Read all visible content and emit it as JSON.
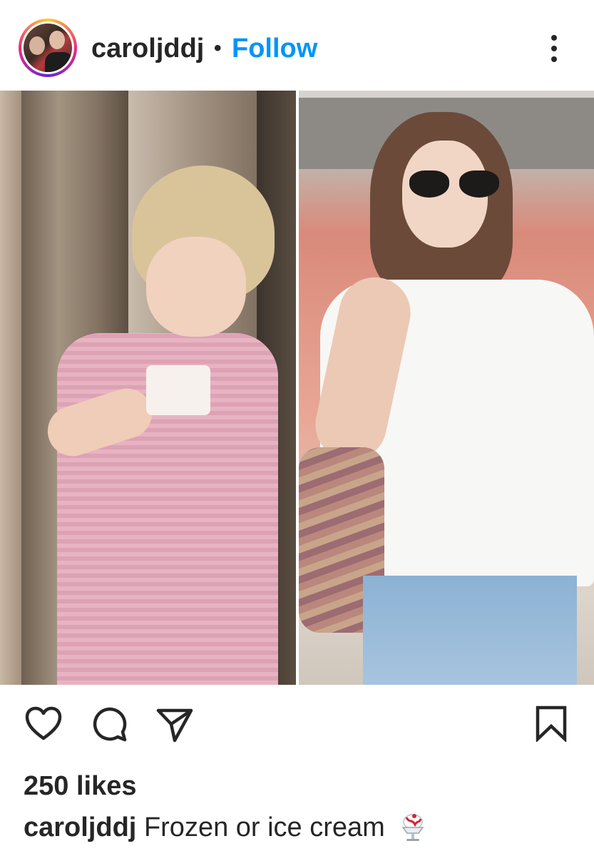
{
  "post": {
    "username": "caroljddj",
    "separator": "•",
    "follow_label": "Follow",
    "more_icon": "more-vertical-icon",
    "likes": "250 likes",
    "caption_user": "caroljddj",
    "caption_text": "Frozen or ice cream",
    "caption_emoji": "shaved-ice-icon"
  },
  "actions": {
    "like_icon": "heart-icon",
    "comment_icon": "comment-icon",
    "share_icon": "paper-plane-icon",
    "save_icon": "bookmark-icon"
  },
  "colors": {
    "text": "#262626",
    "follow": "#0095f6",
    "background": "#ffffff"
  }
}
